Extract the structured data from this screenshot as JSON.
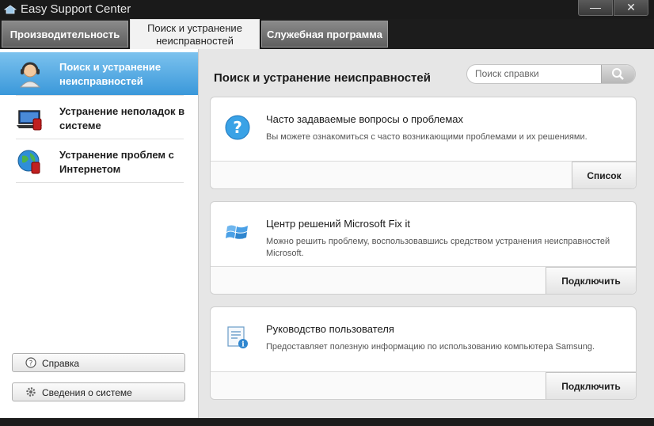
{
  "window": {
    "title": "Easy Support Center",
    "minimize_glyph": "—",
    "close_glyph": "✕"
  },
  "tabs": [
    {
      "label": "Производительность",
      "active": false
    },
    {
      "label": "Поиск и устранение неисправностей",
      "active": true
    },
    {
      "label": "Служебная программа",
      "active": false
    }
  ],
  "sidebar": {
    "items": [
      {
        "label": "Поиск и устранение неисправностей",
        "icon": "support-agent-icon",
        "active": true
      },
      {
        "label": "Устранение неполадок в системе",
        "icon": "laptop-alert-icon",
        "active": false
      },
      {
        "label": "Устранение проблем с Интернетом",
        "icon": "globe-alert-icon",
        "active": false
      }
    ],
    "help_button": "Справка",
    "sysinfo_button": "Сведения о системе"
  },
  "main": {
    "heading": "Поиск и устранение неисправностей",
    "search": {
      "placeholder": "Поиск справки"
    },
    "cards": [
      {
        "title": "Часто задаваемые вопросы о проблемах",
        "description": "Вы можете ознакомиться с часто возникающими проблемами и их решениями.",
        "button": "Список",
        "icon": "question-icon"
      },
      {
        "title": "Центр решений Microsoft Fix it",
        "description": "Можно решить проблему, воспользовавшись средством устранения неисправностей Microsoft.",
        "button": "Подключить",
        "icon": "windows-logo-icon"
      },
      {
        "title": "Руководство пользователя",
        "description": "Предоставляет полезную информацию по использованию компьютера Samsung.",
        "button": "Подключить",
        "icon": "user-guide-icon"
      }
    ]
  },
  "colors": {
    "active_sidebar": "#3a98da",
    "tab_active_bg": "#f2f2f2",
    "tab_inactive_bg": "#6e6e6e",
    "window_chrome": "#1c1c1c"
  }
}
